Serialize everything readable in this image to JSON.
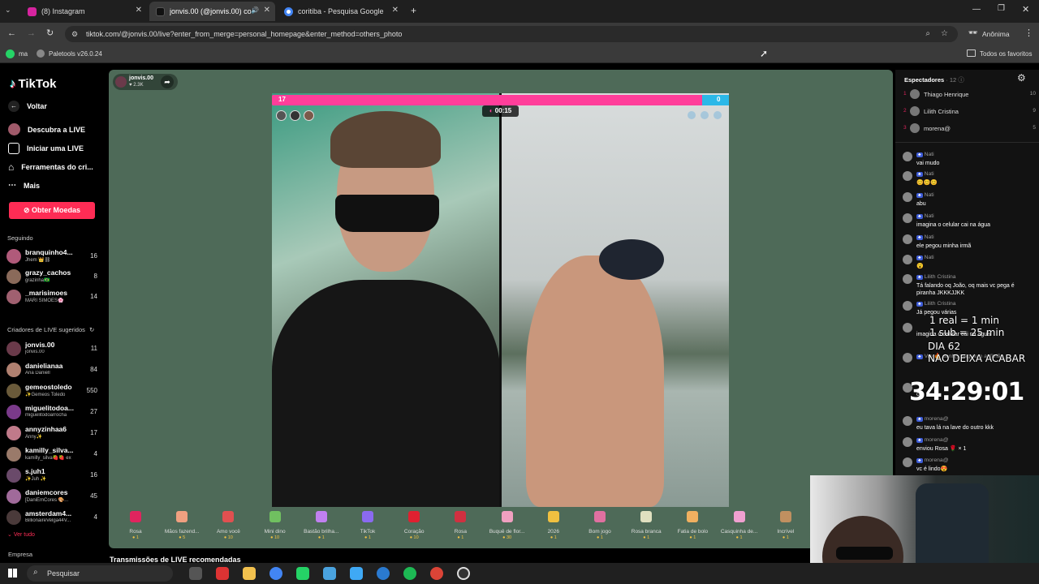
{
  "browser": {
    "tabs": [
      {
        "label": "(8) Instagram",
        "color": "#d6249f"
      },
      {
        "label": "jonvis.00 (@jonvis.00) come",
        "color": "#111111"
      },
      {
        "label": "coritiba - Pesquisa Google",
        "color": "#4285f4"
      }
    ],
    "url": "tiktok.com/@jonvis.00/live?enter_from_merge=personal_homepage&enter_method=others_photo",
    "profile_label": "Anônima",
    "bookmarks": [
      "ma",
      "Paletools v26.0.24"
    ],
    "favorites_label": "Todos os favoritos"
  },
  "sidebar": {
    "logo": "TikTok",
    "back": "Voltar",
    "links": [
      "Descubra a LIVE",
      "Iniciar uma LIVE",
      "Ferramentas do cri...",
      "Mais"
    ],
    "coins_button": "Obter Moedas",
    "following_heading": "Seguindo",
    "following": [
      {
        "name": "branquinho4...",
        "sub": "Jhem 👑⛓",
        "count": "16",
        "color": "#b05a7a"
      },
      {
        "name": "grazy_cachos",
        "sub": "grazinha🇧🇷",
        "count": "8",
        "color": "#8a6a5a"
      },
      {
        "name": "_marisimoes",
        "sub": "MARI SIMÕES🌸",
        "count": "14",
        "color": "#a06070"
      }
    ],
    "suggested_heading": "Criadores de LIVE sugeridos",
    "suggested": [
      {
        "name": "jonvis.00",
        "sub": "jonvis.00",
        "count": "11",
        "color": "#6a3a4a"
      },
      {
        "name": "danielianaa",
        "sub": "Ana Daniell",
        "count": "84",
        "color": "#b08070"
      },
      {
        "name": "gemeostoledo",
        "sub": "✨Gemeos Toledo",
        "count": "550",
        "color": "#6a5a3a"
      },
      {
        "name": "miguelitodoa...",
        "sub": "miguelitodoarrocha",
        "count": "27",
        "color": "#7a3a8a"
      },
      {
        "name": "annyzinhaa6",
        "sub": "Anny✨",
        "count": "17",
        "color": "#c07a8a"
      },
      {
        "name": "kamilly_silva...",
        "sub": "kamilly_silva🍓🍓 ex",
        "count": "4",
        "color": "#9a7a6a"
      },
      {
        "name": "s.juh1",
        "sub": "✨Juh ✨",
        "count": "16",
        "color": "#6a4a6a"
      },
      {
        "name": "daniemcores",
        "sub": "[DaniEmCores 🎨...",
        "count": "45",
        "color": "#a06a9a"
      },
      {
        "name": "amsterdam4...",
        "sub": "BillionaireVelga44V...",
        "count": "4",
        "color": "#4a3a3a"
      }
    ],
    "see_all": "Ver tudo",
    "company": "Empresa"
  },
  "live": {
    "host_name": "jonvis.00",
    "host_likes": "2.3K",
    "score_left": "17",
    "score_right": "0",
    "timer": "00:15",
    "recommended": "Transmissões de LIVE recomendadas"
  },
  "gifts": [
    {
      "name": "Rosa",
      "price": "1",
      "color": "#e0245e"
    },
    {
      "name": "Mãos fazend...",
      "price": "5",
      "color": "#f0a080"
    },
    {
      "name": "Amo você",
      "price": "10",
      "color": "#e05050"
    },
    {
      "name": "Mini dino",
      "price": "10",
      "color": "#70c060"
    },
    {
      "name": "Bastão brilha...",
      "price": "1",
      "color": "#c080f0"
    },
    {
      "name": "TikTok",
      "price": "1",
      "color": "#8a6af0"
    },
    {
      "name": "Coração",
      "price": "10",
      "color": "#e02030"
    },
    {
      "name": "Rosa",
      "price": "1",
      "color": "#d03040"
    },
    {
      "name": "Buquê de flor...",
      "price": "30",
      "color": "#f0a0c0"
    },
    {
      "name": "2026",
      "price": "1",
      "color": "#f0c040"
    },
    {
      "name": "Bom jogo",
      "price": "1",
      "color": "#e070a0"
    },
    {
      "name": "Rosa branca",
      "price": "1",
      "color": "#e0e0c0"
    },
    {
      "name": "Fatia de bolo",
      "price": "1",
      "color": "#f0b060"
    },
    {
      "name": "Casquinha de...",
      "price": "1",
      "color": "#f0a0d0"
    },
    {
      "name": "Incrível",
      "price": "1",
      "color": "#c09060"
    }
  ],
  "viewers": {
    "title": "Espectadores",
    "count": "12",
    "list": [
      {
        "rank": "1",
        "name": "Thiago Henrique",
        "score": "10"
      },
      {
        "rank": "2",
        "name": "Lilith Cristina",
        "score": "9"
      },
      {
        "rank": "3",
        "name": "morena@",
        "score": "5"
      }
    ]
  },
  "chat": [
    {
      "name": "Nati",
      "text": "vai mudo"
    },
    {
      "name": "Nati",
      "text": "😊😊😊"
    },
    {
      "name": "Nati",
      "text": "abu"
    },
    {
      "name": "Nati",
      "text": "imagina o celular cai na água"
    },
    {
      "name": "Nati",
      "text": "ele pegou minha irmã"
    },
    {
      "name": "Nati",
      "text": "😮"
    },
    {
      "name": "Lilith Cristina",
      "text": "Tá falando oq João, oq mais vc pega é piranha JKKKJJKK"
    },
    {
      "name": "Lilith Cristina",
      "text": "Já pegou várias"
    },
    {
      "name": "",
      "text": "imagina o celular cai na água"
    },
    {
      "name": "Vro 🔥 danh(): seguiu o anfitrião",
      "text": ""
    },
    {
      "name": "",
      "text": "oi"
    },
    {
      "name": "morena@",
      "text": "eu tava lá na lave do outro kkk"
    },
    {
      "name": "morena@",
      "text": "enviou Rosa 🌹 × 1"
    },
    {
      "name": "morena@",
      "text": "vc é lindo😍"
    }
  ],
  "overlay": {
    "line1": "1 real = 1 min",
    "line2": "1 sub = 25 min",
    "line3": "DIA 62",
    "line4": "NAO DEIXA ACABAR",
    "clock": "34:29:01"
  },
  "taskbar": {
    "search": "Pesquisar"
  }
}
